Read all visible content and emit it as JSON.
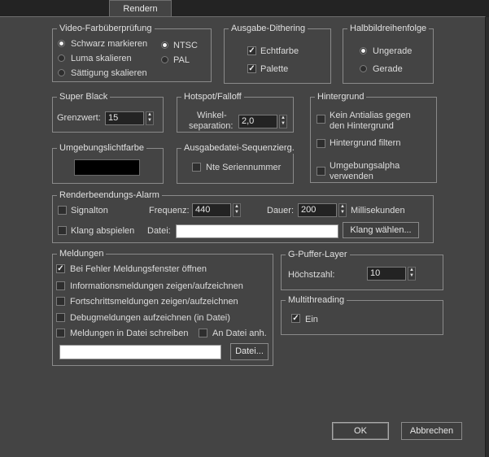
{
  "tabs": [
    {
      "label": "Rendern"
    }
  ],
  "video_check": {
    "title": "Video-Farbüberprüfung",
    "options": [
      {
        "label": "Schwarz markieren",
        "selected": true
      },
      {
        "label": "Luma skalieren",
        "selected": false
      },
      {
        "label": "Sättigung skalieren",
        "selected": false
      }
    ],
    "standards": [
      {
        "label": "NTSC",
        "selected": true
      },
      {
        "label": "PAL",
        "selected": false
      }
    ]
  },
  "dithering": {
    "title": "Ausgabe-Dithering",
    "items": [
      {
        "label": "Echtfarbe",
        "checked": true
      },
      {
        "label": "Palette",
        "checked": true
      }
    ]
  },
  "field_order": {
    "title": "Halbbildreihenfolge",
    "options": [
      {
        "label": "Ungerade",
        "selected": true
      },
      {
        "label": "Gerade",
        "selected": false
      }
    ]
  },
  "super_black": {
    "title": "Super Black",
    "threshold_label": "Grenzwert:",
    "threshold_value": "15"
  },
  "hotspot": {
    "title": "Hotspot/Falloff",
    "angle_label_1": "Winkel-",
    "angle_label_2": "separation:",
    "angle_value": "2,0"
  },
  "background": {
    "title": "Hintergrund",
    "items": [
      {
        "label_1": "Kein Antialias gegen",
        "label_2": "den Hintergrund",
        "checked": false
      },
      {
        "label_1": "Hintergrund filtern",
        "label_2": "",
        "checked": false
      },
      {
        "label_1": "Umgebungsalpha",
        "label_2": "verwenden",
        "checked": false
      }
    ]
  },
  "ambient": {
    "title": "Umgebungslichtfarbe",
    "color": "#000000"
  },
  "output_seq": {
    "title": "Ausgabedatei-Sequenzierg.",
    "nth_label": "Nte Seriennummer",
    "nth_checked": false
  },
  "alarm": {
    "title": "Renderbeendungs-Alarm",
    "signal_label": "Signalton",
    "signal_checked": false,
    "frequency_label": "Frequenz:",
    "frequency_value": "440",
    "duration_label": "Dauer:",
    "duration_value": "200",
    "unit_label": "Millisekunden",
    "play_label": "Klang abspielen",
    "play_checked": false,
    "file_label": "Datei:",
    "file_value": "",
    "choose_button": "Klang wählen..."
  },
  "messages": {
    "title": "Meldungen",
    "items": [
      {
        "label": "Bei Fehler Meldungsfenster öffnen",
        "checked": true
      },
      {
        "label": "Informationsmeldungen zeigen/aufzeichnen",
        "checked": false
      },
      {
        "label": "Fortschrittsmeldungen zeigen/aufzeichnen",
        "checked": false
      },
      {
        "label": "Debugmeldungen aufzeichnen (in Datei)",
        "checked": false
      },
      {
        "label": "Meldungen in Datei schreiben",
        "checked": false
      }
    ],
    "append_label": "An Datei anh.",
    "append_checked": false,
    "file_value": "",
    "file_button": "Datei..."
  },
  "gbuffer": {
    "title": "G-Puffer-Layer",
    "max_label": "Höchstzahl:",
    "max_value": "10"
  },
  "multithreading": {
    "title": "Multithreading",
    "on_label": "Ein",
    "on_checked": true
  },
  "footer": {
    "ok": "OK",
    "cancel": "Abbrechen"
  }
}
